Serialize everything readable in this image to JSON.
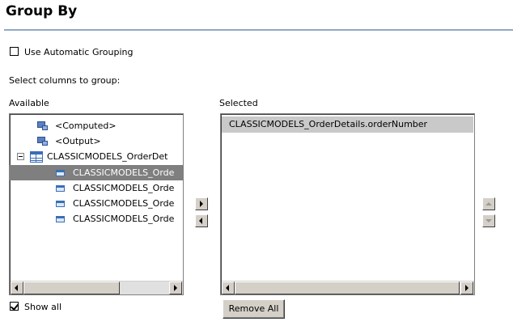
{
  "title": "Group By",
  "auto_grouping": {
    "label": "Use Automatic Grouping",
    "checked": false
  },
  "select_label": "Select columns to group:",
  "available": {
    "label": "Available",
    "items": [
      {
        "text": "<Computed>",
        "icon": "computed-column-icon"
      },
      {
        "text": "<Output>",
        "icon": "output-column-icon"
      },
      {
        "text": "CLASSICMODELS_OrderDet",
        "icon": "table-icon",
        "expanded": true
      },
      {
        "text": "CLASSICMODELS_Orde",
        "icon": "column-icon",
        "selected": true
      },
      {
        "text": "CLASSICMODELS_Orde",
        "icon": "column-icon"
      },
      {
        "text": "CLASSICMODELS_Orde",
        "icon": "column-icon"
      },
      {
        "text": "CLASSICMODELS_Orde",
        "icon": "column-icon"
      }
    ]
  },
  "selected": {
    "label": "Selected",
    "items": [
      {
        "text": "CLASSICMODELS_OrderDetails.orderNumber"
      }
    ]
  },
  "show_all": {
    "label": "Show all",
    "checked": true
  },
  "remove_all_label": "Remove All",
  "colors": {
    "title_rule": "#8fa8c8",
    "selection": "#7f7f7f",
    "selected_row": "#c9c9c9"
  }
}
